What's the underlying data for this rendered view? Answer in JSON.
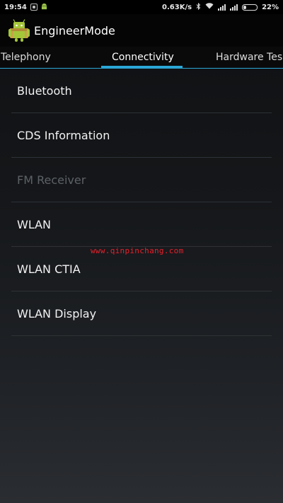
{
  "status_bar": {
    "time": "19:54",
    "net_speed": "0.63K/s",
    "battery_pct": "22%",
    "battery_level": 0.22,
    "icons": [
      "notification-box-icon",
      "android-notification-icon",
      "bluetooth-icon",
      "wifi-icon",
      "signal-icon",
      "signal-icon",
      "battery-icon"
    ]
  },
  "action_bar": {
    "title": "EngineerMode",
    "icon": "android-robot-icon"
  },
  "tabs": [
    {
      "label": "Telephony",
      "selected": false
    },
    {
      "label": "Connectivity",
      "selected": true
    },
    {
      "label": "Hardware Tes",
      "selected": false
    }
  ],
  "list_items": [
    {
      "label": "Bluetooth",
      "enabled": true
    },
    {
      "label": "CDS Information",
      "enabled": true
    },
    {
      "label": "FM Receiver",
      "enabled": false
    },
    {
      "label": "WLAN",
      "enabled": true
    },
    {
      "label": "WLAN CTIA",
      "enabled": true
    },
    {
      "label": "WLAN Display",
      "enabled": true
    }
  ],
  "watermark": "www.qinpinchang.com",
  "colors": {
    "accent": "#2aa7d6",
    "watermark": "#e8202a",
    "disabled_text": "#5d6166"
  }
}
